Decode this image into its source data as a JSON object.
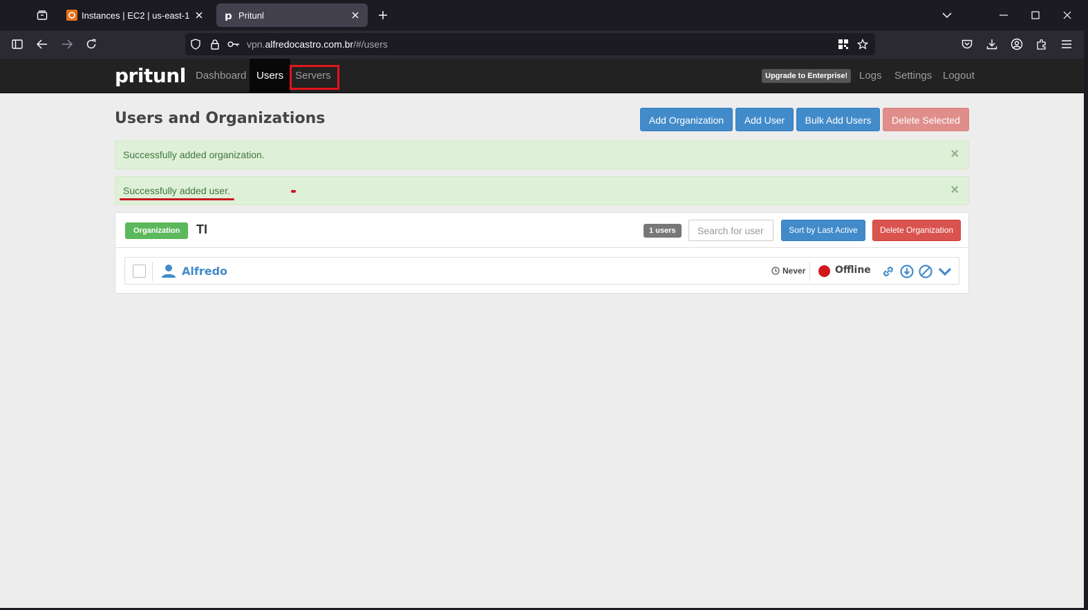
{
  "browser": {
    "tabs": [
      {
        "title": "Instances | EC2 | us-east-1",
        "active": false
      },
      {
        "title": "Pritunl",
        "active": true
      }
    ],
    "url": {
      "prefix": "vpn.",
      "host": "alfredocastro.com.br",
      "path": "/#/users"
    }
  },
  "app": {
    "brand": "pritunl",
    "nav": {
      "dashboard": "Dashboard",
      "users": "Users",
      "servers": "Servers",
      "upgrade": "Upgrade to Enterprise!",
      "logs": "Logs",
      "settings": "Settings",
      "logout": "Logout"
    },
    "page_title": "Users and Organizations",
    "actions": {
      "add_org": "Add Organization",
      "add_user": "Add User",
      "bulk_add": "Bulk Add Users",
      "delete_selected": "Delete Selected"
    },
    "alerts": [
      {
        "message": "Successfully added organization.",
        "close": "×"
      },
      {
        "message": "Successfully added user.",
        "close": "×"
      }
    ],
    "organization": {
      "label": "Organization",
      "name": "TI",
      "user_count": "1 users",
      "search_placeholder": "Search for user",
      "sort_button": "Sort by Last Active",
      "delete_button": "Delete Organization",
      "users": [
        {
          "name": "Alfredo",
          "last_active": "Never",
          "status": "Offline",
          "status_color": "#d2171c"
        }
      ]
    },
    "colors": {
      "primary": "#428bca",
      "danger": "#d9534f",
      "success": "#5cb85c",
      "alert_bg": "#dff0d8",
      "annotation_red": "#e3141c"
    }
  }
}
